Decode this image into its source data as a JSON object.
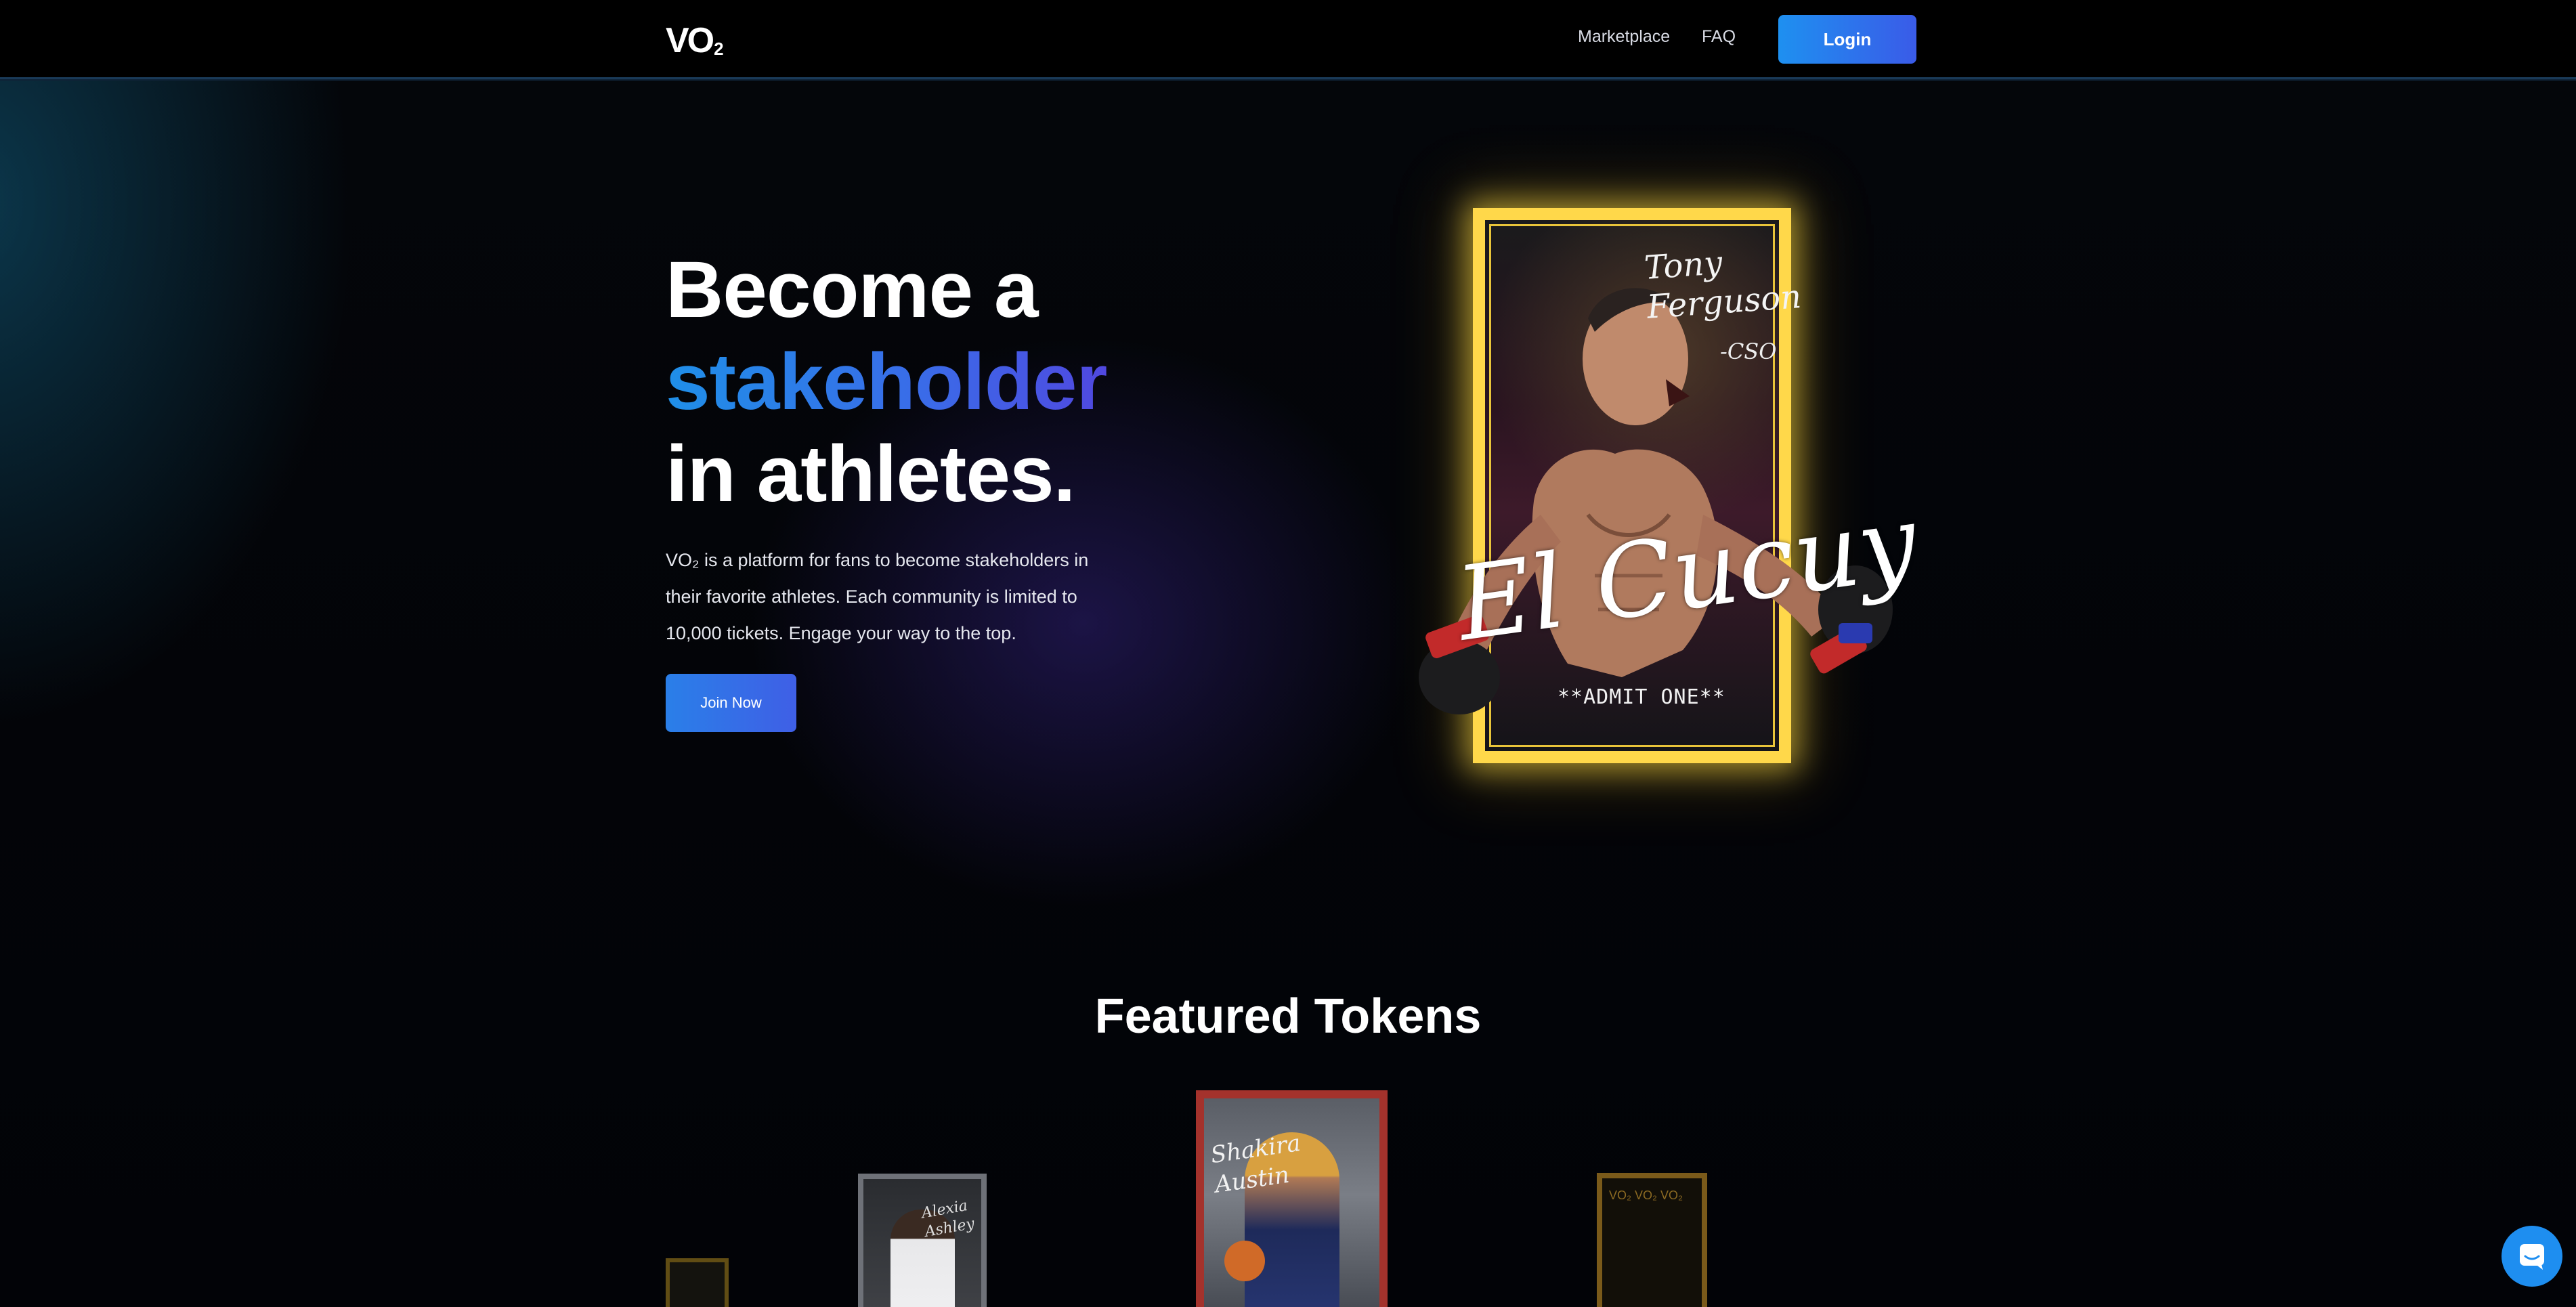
{
  "nav": {
    "logo_main": "VO",
    "logo_sub": "2",
    "links": [
      "Marketplace",
      "FAQ"
    ],
    "login_label": "Login"
  },
  "hero": {
    "title_line1": "Become a",
    "title_line2": "stakeholder",
    "title_line3": "in athletes.",
    "description": "VO₂ is a platform for fans to become stakeholders in their favorite athletes. Each community is limited to 10,000 tickets. Engage your way to the top.",
    "cta_label": "Join Now",
    "card": {
      "signature_top": "Tony Ferguson",
      "signature_tag": "-CSO",
      "nickname": "El Cucuy",
      "ticket_text": "**ADMIT ONE**"
    }
  },
  "featured": {
    "title": "Featured Tokens",
    "tokens": [
      {
        "signature": ""
      },
      {
        "signature": "Alexia Ashley"
      },
      {
        "signature": "Shakira Austin"
      },
      {
        "signature": ""
      }
    ],
    "pattern_text": "VO₂ VO₂ VO₂"
  },
  "colors": {
    "accent_blue": "#1e90f0",
    "accent_indigo": "#3a5be8",
    "card_gold": "#ffd84a",
    "token_red": "#a4322c"
  },
  "icons": [
    "chat-icon"
  ]
}
